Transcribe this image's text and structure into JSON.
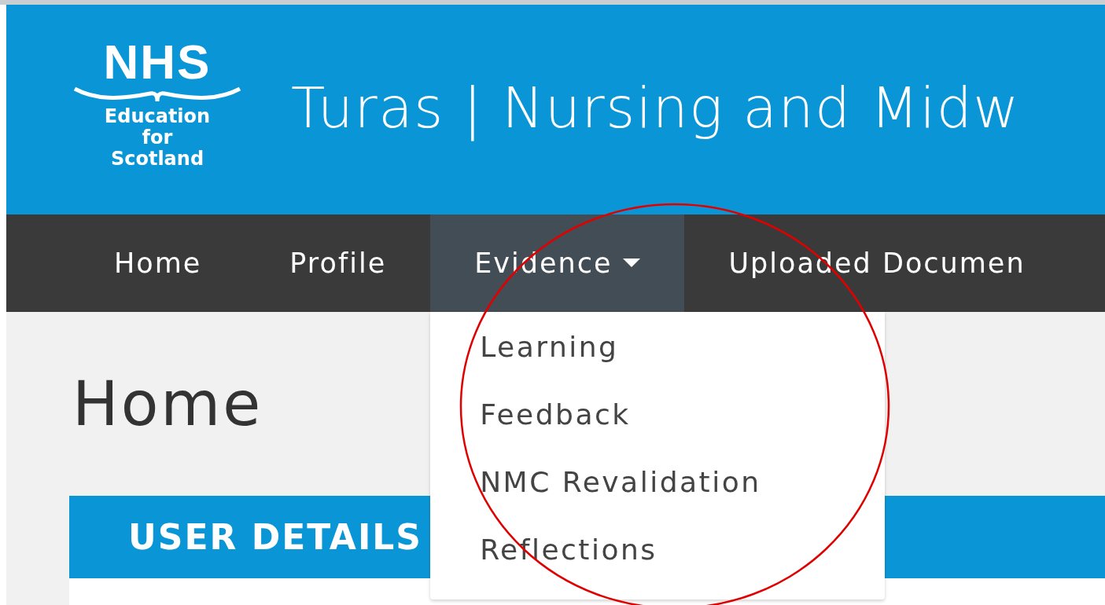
{
  "logo": {
    "mark": "NHS",
    "lines": [
      "Education",
      "for",
      "Scotland"
    ]
  },
  "header": {
    "title": "Turas | Nursing and Midw"
  },
  "nav": [
    {
      "label": "Home",
      "selected": false
    },
    {
      "label": "Profile",
      "selected": false
    },
    {
      "label": "Evidence",
      "selected": true,
      "menu": [
        "Learning",
        "Feedback",
        "NMC Revalidation",
        "Reflections"
      ]
    },
    {
      "label": "Uploaded Documen",
      "selected": false
    }
  ],
  "page": {
    "heading": "Home"
  },
  "card": {
    "title": "USER DETAILS"
  },
  "annotation": {
    "kind": "circle"
  }
}
